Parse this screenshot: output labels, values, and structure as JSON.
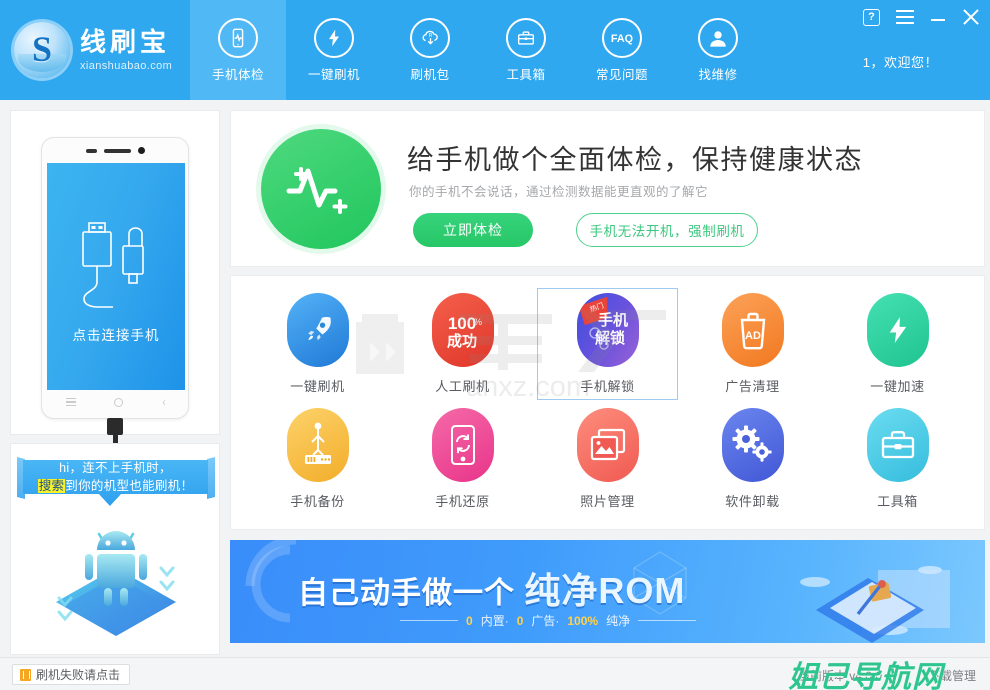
{
  "window": {
    "controls": [
      {
        "name": "help",
        "glyph": "?"
      },
      {
        "name": "menu",
        "glyph": "☰"
      },
      {
        "name": "minimize",
        "glyph": "—"
      },
      {
        "name": "close",
        "glyph": "✕"
      }
    ]
  },
  "brand": {
    "mark_letter": "S",
    "name_cn": "线刷宝",
    "name_en": "xianshuabao.com"
  },
  "nav": {
    "items": [
      {
        "label": "手机体检",
        "icon": "phone-check-icon",
        "active": true
      },
      {
        "label": "一键刷机",
        "icon": "lightning-icon",
        "active": false
      },
      {
        "label": "刷机包",
        "icon": "rom-cloud-download-icon",
        "active": false
      },
      {
        "label": "工具箱",
        "icon": "toolbox-icon",
        "active": false
      },
      {
        "label": "常见问题",
        "icon": "faq-icon",
        "active": false
      },
      {
        "label": "找维修",
        "icon": "user-repair-icon",
        "active": false
      }
    ],
    "welcome": "1，欢迎您！"
  },
  "left_panel": {
    "connect_text": "点击连接手机",
    "phone_nav": [
      "menu-icon",
      "home-icon",
      "back-icon"
    ]
  },
  "promo": {
    "bubble_line1": "hi，连不上手机时，",
    "bubble_highlight": "搜索",
    "bubble_line2_rest": "到你的机型也能刷机！",
    "mascot": "android-robot-icon"
  },
  "hero": {
    "badge_icon": "heartbeat-icon",
    "title": "给手机做个全面体检，保持健康状态",
    "subtitle": "你的手机不会说话，通过检测数据能更直观的了解它",
    "primary_button": "立即体检",
    "ghost_button": "手机无法开机，强制刷机"
  },
  "grid": {
    "tiles": [
      {
        "label": "一键刷机",
        "icon": "rocket-icon",
        "color": "#3a9bf0",
        "color2": "#1f79d6",
        "selected": false
      },
      {
        "label": "人工刷机",
        "icon": "hundred-percent-icon",
        "color": "#f04b3c",
        "color2": "#e0362a",
        "selected": false
      },
      {
        "label": "手机解锁",
        "icon": "phone-unlock-icon",
        "color": "#4a5ae0",
        "color2": "#8a4fd8",
        "selected": true
      },
      {
        "label": "广告清理",
        "icon": "ad-trash-icon",
        "color": "#fa9242",
        "color2": "#f2781f",
        "selected": false
      },
      {
        "label": "一键加速",
        "icon": "speed-bolt-icon",
        "color": "#34d9a6",
        "color2": "#1fc490",
        "selected": false
      },
      {
        "label": "手机备份",
        "icon": "backup-usb-icon",
        "color": "#fcc44d",
        "color2": "#f2ad2a",
        "selected": false
      },
      {
        "label": "手机还原",
        "icon": "phone-restore-icon",
        "color": "#f2559b",
        "color2": "#e8348a",
        "selected": false
      },
      {
        "label": "照片管理",
        "icon": "photo-gallery-icon",
        "color": "#fa7a6b",
        "color2": "#f05a52",
        "selected": false
      },
      {
        "label": "软件卸载",
        "icon": "gears-uninstall-icon",
        "color": "#5a79e8",
        "color2": "#4257d6",
        "selected": false
      },
      {
        "label": "工具箱",
        "icon": "toolbox-icon",
        "color": "#5cd2ea",
        "color2": "#35bddd",
        "selected": false
      }
    ]
  },
  "banner": {
    "title_prefix": "自己动手做一个",
    "title_big": "纯净ROM",
    "sub_parts": [
      {
        "text": "0",
        "type": "num"
      },
      {
        "text": "内置·",
        "type": "txt"
      },
      {
        "text": "0",
        "type": "num"
      },
      {
        "text": "广告·",
        "type": "txt"
      },
      {
        "text": "100%",
        "type": "num"
      },
      {
        "text": "纯净",
        "type": "txt"
      }
    ]
  },
  "statusbar": {
    "fail_button": "刷机失败请点击",
    "version": "当前版本 v4.0.0",
    "download_manager": "下载管理"
  },
  "watermarks": {
    "gray": "anxz.com",
    "green": "姐己导航网"
  },
  "colors": {
    "header_blue": "#2fa8f0",
    "nav_active": "#50b9f5",
    "green_accent": "#2ecc71",
    "selected_border": "#9fc9ef"
  }
}
